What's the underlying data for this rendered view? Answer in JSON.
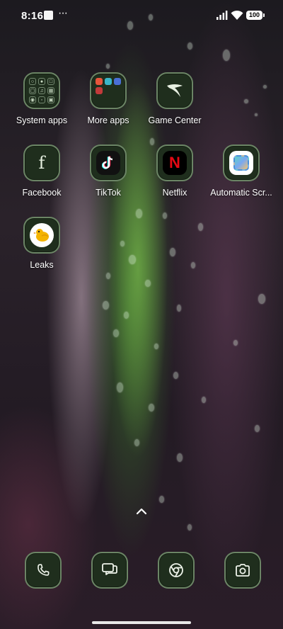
{
  "status_bar": {
    "time": "8:16",
    "overflow": "···",
    "battery_level": "100",
    "icons": [
      "notification-square-icon",
      "signal-icon",
      "wifi-icon",
      "battery-icon"
    ]
  },
  "apps": [
    {
      "label": "System apps",
      "icon": "folder-icon"
    },
    {
      "label": "More apps",
      "icon": "folder-icon"
    },
    {
      "label": "Game Center",
      "icon": "game-center-icon"
    },
    {
      "label": "Facebook",
      "icon": "facebook-icon"
    },
    {
      "label": "TikTok",
      "icon": "tiktok-icon"
    },
    {
      "label": "Netflix",
      "icon": "netflix-icon"
    },
    {
      "label": "Automatic Scr...",
      "icon": "automatic-screenshot-icon"
    },
    {
      "label": "Leaks",
      "icon": "leaks-icon"
    }
  ],
  "netflix_glyph": "N",
  "facebook_glyph": "f",
  "dock": [
    {
      "icon": "phone-icon"
    },
    {
      "icon": "messages-icon"
    },
    {
      "icon": "chrome-icon"
    },
    {
      "icon": "camera-icon"
    }
  ],
  "colors": {
    "tile_bg": "#1f2e1d",
    "tile_border": "#aacda0",
    "netflix_red": "#e50914"
  }
}
